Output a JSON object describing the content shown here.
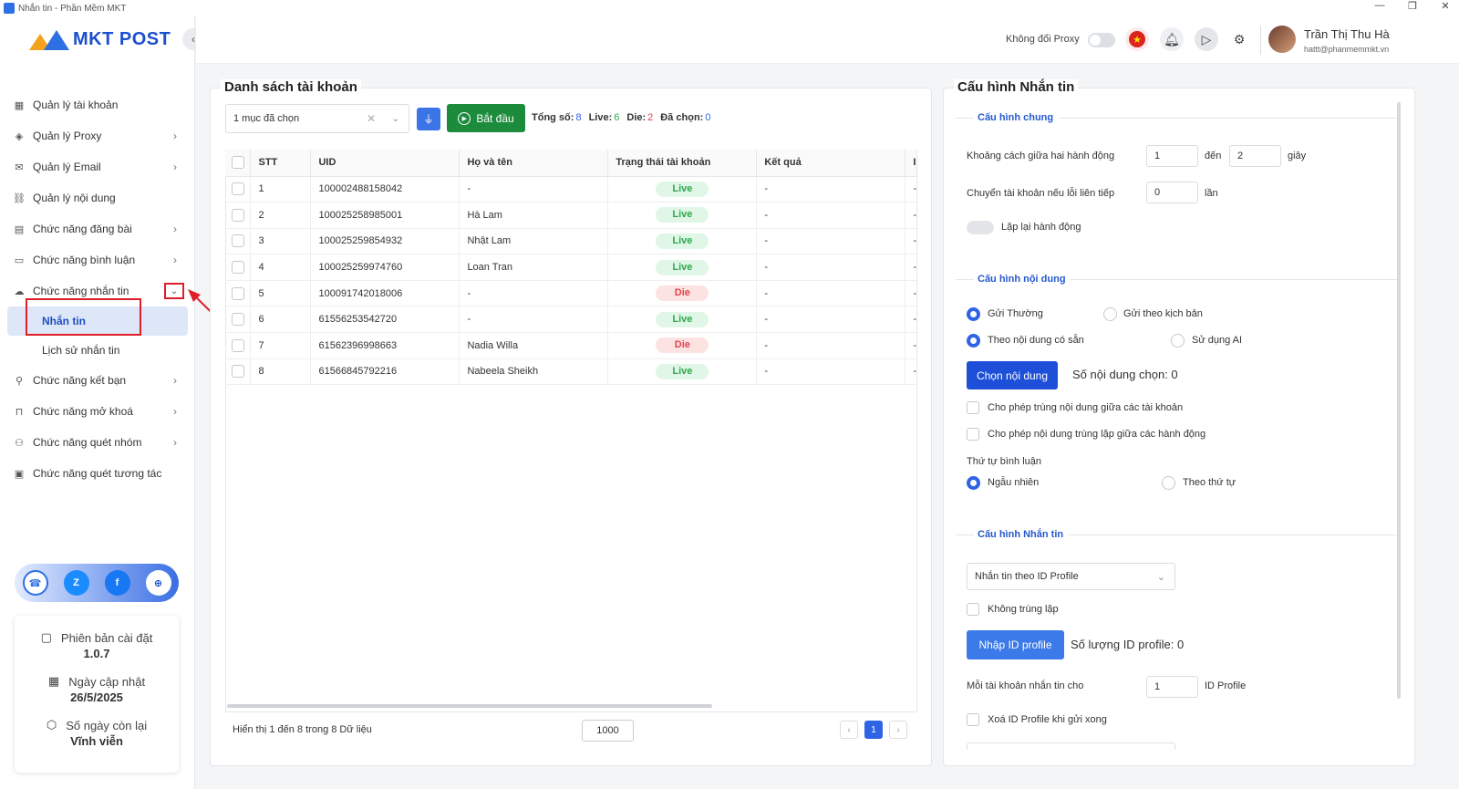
{
  "window": {
    "title": "Nhắn tin - Phần Mềm MKT",
    "controls": [
      "—",
      "❐",
      "✕"
    ]
  },
  "logo": {
    "text": "MKT POST"
  },
  "sidebar": {
    "items": [
      {
        "label": "Quản lý tài khoản",
        "icon": "grid-icon",
        "chevron": ""
      },
      {
        "label": "Quản lý Proxy",
        "icon": "layers-icon",
        "chevron": "›"
      },
      {
        "label": "Quản lý Email",
        "icon": "mail-icon",
        "chevron": "›"
      },
      {
        "label": "Quản lý nội dung",
        "icon": "link-icon",
        "chevron": ""
      },
      {
        "label": "Chức năng đăng bài",
        "icon": "post-icon",
        "chevron": "›"
      },
      {
        "label": "Chức năng bình luận",
        "icon": "comment-icon",
        "chevron": "›"
      },
      {
        "label": "Chức năng nhắn tin",
        "icon": "chat-icon",
        "chevron": "⌄"
      }
    ],
    "sub_items": [
      {
        "label": "Nhắn tin"
      },
      {
        "label": "Lịch sử nhắn tin"
      }
    ],
    "items_after": [
      {
        "label": "Chức năng kết bạn",
        "icon": "add-user-icon",
        "chevron": "›"
      },
      {
        "label": "Chức năng mở khoá",
        "icon": "lock-icon",
        "chevron": "›"
      },
      {
        "label": "Chức năng quét nhóm",
        "icon": "group-icon",
        "chevron": "›"
      },
      {
        "label": "Chức năng quét tương tác",
        "icon": "scan-icon",
        "chevron": ""
      }
    ],
    "social": [
      "support-icon",
      "zalo-icon",
      "facebook-icon",
      "globe-icon"
    ],
    "info": {
      "version_label": "Phiên bản cài đặt",
      "version": "1.0.7",
      "update_label": "Ngày cập nhật",
      "update": "26/5/2025",
      "remaining_label": "Số ngày còn lại",
      "remaining": "Vĩnh viễn"
    }
  },
  "topbar": {
    "proxy_label": "Không đổi Proxy",
    "user_name": "Trần Thị Thu Hà",
    "user_email": "hattt@phanmemmkt.vn"
  },
  "accounts": {
    "title": "Danh sách tài khoản",
    "select_value": "1 mục đã chọn",
    "start_label": "Bắt đầu",
    "stats": {
      "total_label": "Tổng số:",
      "total": "8",
      "live_label": "Live:",
      "live": "6",
      "die_label": "Die:",
      "die": "2",
      "selected_label": "Đã chọn:",
      "selected": "0"
    },
    "columns": [
      "STT",
      "UID",
      "Họ và tên",
      "Trạng thái tài khoản",
      "Kết quả",
      "I"
    ],
    "rows": [
      {
        "stt": "1",
        "uid": "100002488158042",
        "name": "-",
        "status": "Live",
        "result": "-"
      },
      {
        "stt": "2",
        "uid": "100025258985001",
        "name": "Hà Lam",
        "status": "Live",
        "result": "-"
      },
      {
        "stt": "3",
        "uid": "100025259854932",
        "name": "Nhật Lam",
        "status": "Live",
        "result": "-"
      },
      {
        "stt": "4",
        "uid": "100025259974760",
        "name": "Loan Tran",
        "status": "Live",
        "result": "-"
      },
      {
        "stt": "5",
        "uid": "100091742018006",
        "name": "-",
        "status": "Die",
        "result": "-"
      },
      {
        "stt": "6",
        "uid": "61556253542720",
        "name": "-",
        "status": "Live",
        "result": "-"
      },
      {
        "stt": "7",
        "uid": "61562396998663",
        "name": "Nadia Willa",
        "status": "Die",
        "result": "-"
      },
      {
        "stt": "8",
        "uid": "61566845792216",
        "name": "Nabeela Sheikh",
        "status": "Live",
        "result": "-"
      }
    ],
    "footer": "Hiển thị 1 đến 8 trong 8 Dữ liệu",
    "page_size": "1000",
    "page": "1"
  },
  "config": {
    "title": "Cấu hình Nhắn tin",
    "general": {
      "title": "Cấu hình chung",
      "delay_label": "Khoảng cách giữa hai hành động",
      "delay_from": "1",
      "to_label": "đến",
      "delay_to": "2",
      "unit_sec": "giây",
      "switch_label": "Chuyển tài khoản nếu lỗi liên tiếp",
      "switch_value": "0",
      "unit_times": "lần",
      "repeat_label": "Lặp lại hành động"
    },
    "content": {
      "title": "Cấu hình nội dung",
      "send_normal": "Gửi Thường",
      "send_script": "Gửi theo kịch bản",
      "by_content": "Theo nội dung có sẵn",
      "use_ai": "Sử dụng AI",
      "choose_btn": "Chọn nội dung",
      "chosen_count": "Số nội dung chọn: 0",
      "allow_dup_accounts": "Cho phép trùng nội dung giữa các tài khoản",
      "allow_dup_actions": "Cho phép nội dung trùng lặp giữa các hành động",
      "order_label": "Thứ tự bình luận",
      "random": "Ngẫu nhiên",
      "sequential": "Theo thứ tự"
    },
    "message": {
      "title": "Cấu hình Nhắn tin",
      "mode": "Nhắn tin theo ID Profile",
      "no_dup": "Không trùng lặp",
      "import_btn": "Nhập ID profile",
      "id_count": "Số lượng ID profile: 0",
      "per_account_label": "Mỗi tài khoản nhắn tin cho",
      "per_account_value": "1",
      "per_account_unit": "ID Profile",
      "delete_after": "Xoá ID Profile khi gửi xong"
    }
  },
  "colors": {
    "accent": "#2f63e6",
    "green": "#1c8b3c",
    "red": "#e01e2a"
  }
}
